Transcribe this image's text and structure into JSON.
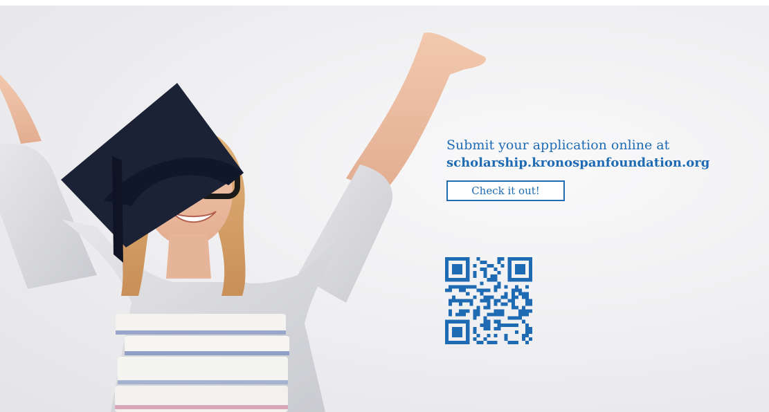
{
  "promo": {
    "headline_line1": "Submit your application online at",
    "headline_line2": "scholarship.kronospanfoundation.org",
    "button_label": "Check it out!"
  },
  "colors": {
    "accent": "#1f6bb3",
    "background": "#efeff1"
  },
  "icons": {
    "qr": "qr-code-icon"
  }
}
